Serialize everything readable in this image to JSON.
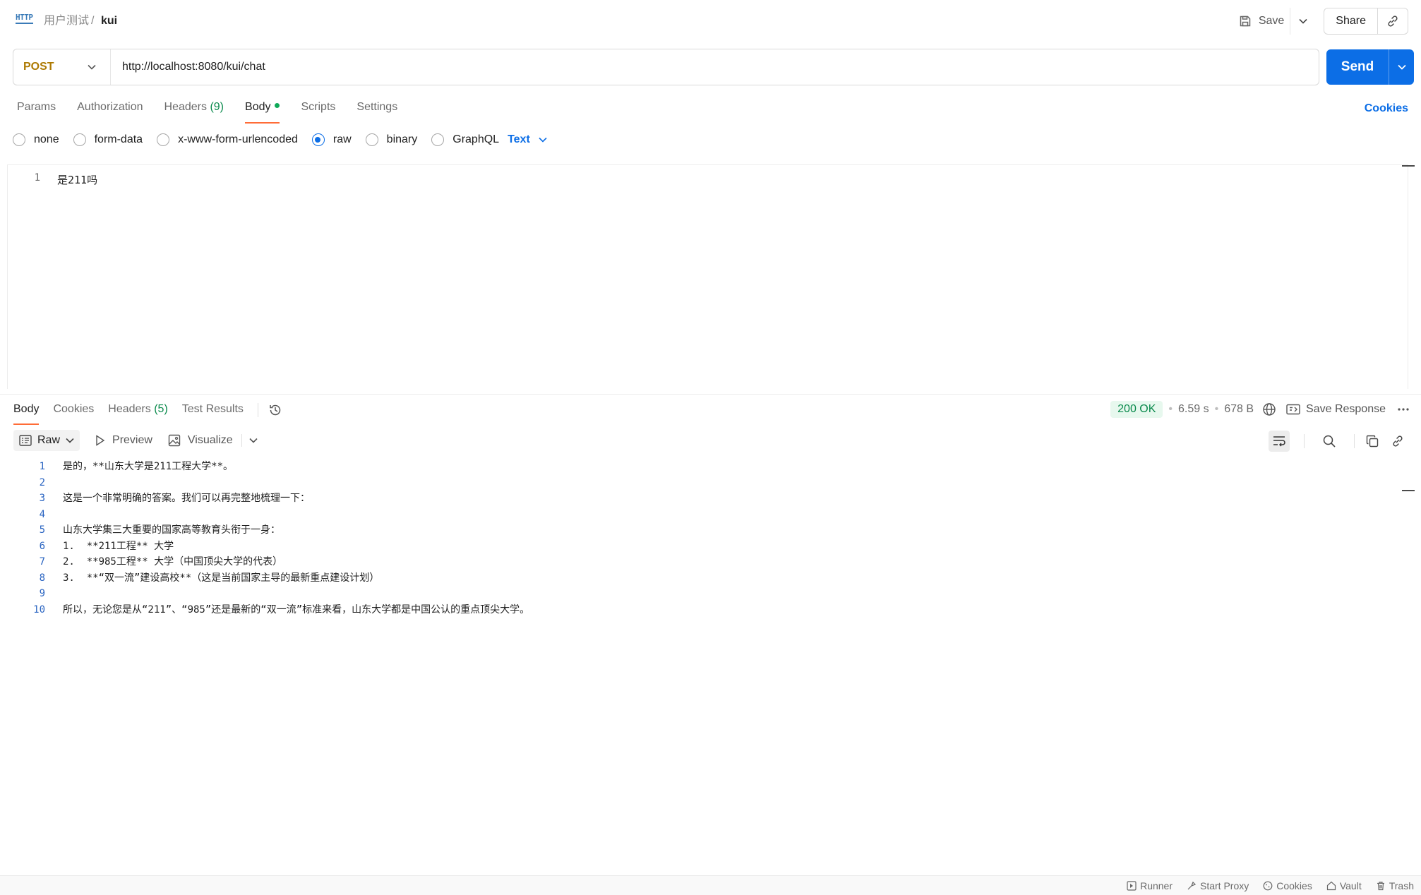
{
  "breadcrumb": {
    "icon_text": "HTTP",
    "parent": "用户测试",
    "separator": "/",
    "current": "kui"
  },
  "toolbar": {
    "save_label": "Save",
    "share_label": "Share"
  },
  "request": {
    "method": "POST",
    "url": "http://localhost:8080/kui/chat",
    "send_label": "Send",
    "tabs": [
      {
        "label": "Params"
      },
      {
        "label": "Authorization"
      },
      {
        "label": "Headers",
        "count": "(9)"
      },
      {
        "label": "Body"
      },
      {
        "label": "Scripts"
      },
      {
        "label": "Settings"
      }
    ],
    "cookies_label": "Cookies",
    "body_types": [
      "none",
      "form-data",
      "x-www-form-urlencoded",
      "raw",
      "binary",
      "GraphQL"
    ],
    "body_type_selected": "raw",
    "format": "Text",
    "body_lines": [
      {
        "num": "1",
        "text": "是211吗"
      }
    ]
  },
  "response": {
    "tabs": [
      {
        "label": "Body"
      },
      {
        "label": "Cookies"
      },
      {
        "label": "Headers",
        "count": "(5)"
      },
      {
        "label": "Test Results"
      }
    ],
    "status": "200 OK",
    "time": "6.59 s",
    "size": "678 B",
    "save_response_label": "Save Response",
    "view_mode": "Raw",
    "preview_label": "Preview",
    "visualize_label": "Visualize",
    "lines": [
      {
        "num": "1",
        "text": "是的，**山东大学是211工程大学**。"
      },
      {
        "num": "2",
        "text": ""
      },
      {
        "num": "3",
        "text": "这是一个非常明确的答案。我们可以再完整地梳理一下："
      },
      {
        "num": "4",
        "text": ""
      },
      {
        "num": "5",
        "text": "山东大学集三大重要的国家高等教育头衔于一身："
      },
      {
        "num": "6",
        "text": "1.  **211工程** 大学"
      },
      {
        "num": "7",
        "text": "2.  **985工程** 大学（中国顶尖大学的代表）"
      },
      {
        "num": "8",
        "text": "3.  **“双一流”建设高校**（这是当前国家主导的最新重点建设计划）"
      },
      {
        "num": "9",
        "text": ""
      },
      {
        "num": "10",
        "text": "所以，无论您是从“211”、“985”还是最新的“双一流”标准来看，山东大学都是中国公认的重点顶尖大学。"
      }
    ]
  },
  "statusbar": {
    "runner": "Runner",
    "proxy": "Start Proxy",
    "cookies": "Cookies",
    "vault": "Vault",
    "trash": "Trash"
  },
  "colors": {
    "accent": "#0c6ee6",
    "method": "#ad7a03",
    "tab_indicator": "#ff6c37",
    "status_ok": "#0a8a4c"
  }
}
